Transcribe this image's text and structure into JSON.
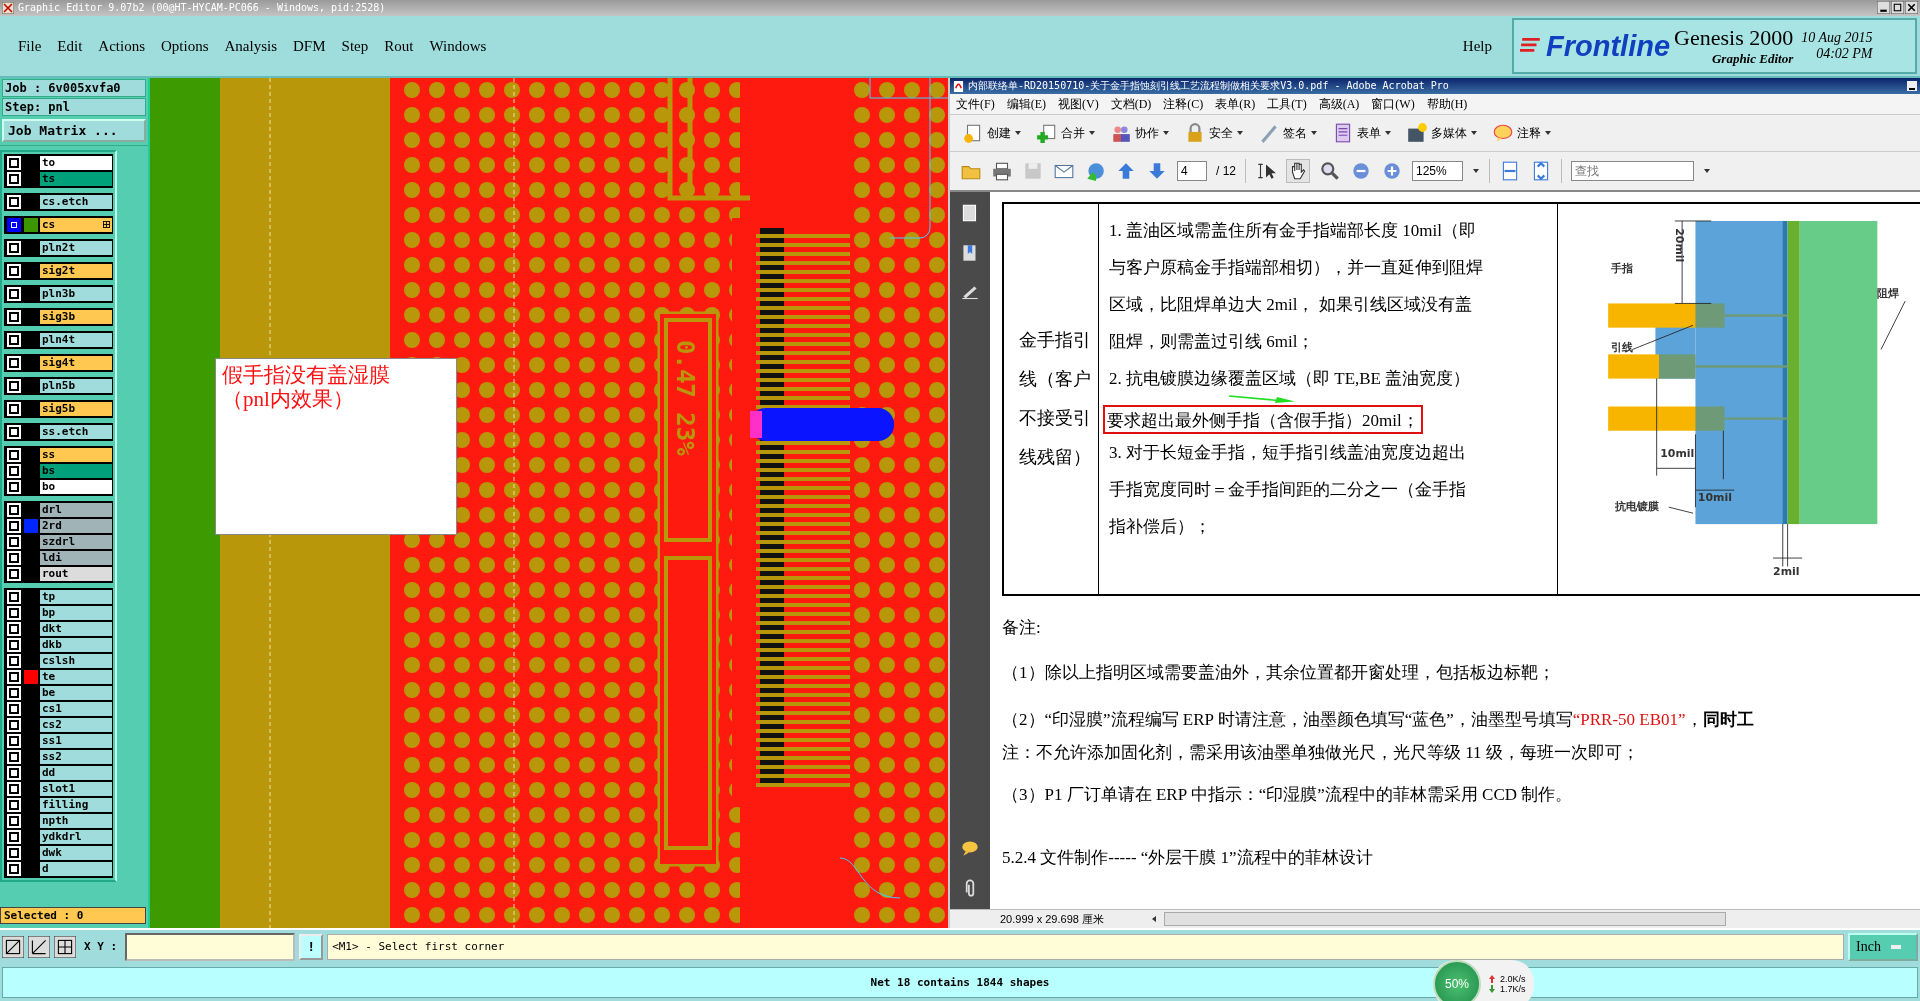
{
  "title_bar": {
    "title": "Graphic Editor 9.07b2 (00@HT-HYCAM-PC066 - Windows, pid:2528)"
  },
  "menu": [
    "File",
    "Edit",
    "Actions",
    "Options",
    "Analysis",
    "DFM",
    "Step",
    "Rout",
    "Windows"
  ],
  "help": "Help",
  "brand": {
    "logo": "Frontline",
    "product": "Genesis 2000",
    "subtitle": "Graphic Editor",
    "date": "10 Aug 2015",
    "time": "04:02 PM"
  },
  "job": {
    "job": "Job : 6v005xvfa0",
    "step": "Step: pnl",
    "matrix_button": "Job Matrix ..."
  },
  "layer_groups": [
    {
      "layers": [
        {
          "name": "to",
          "color": "#ffffff",
          "selected": false
        },
        {
          "name": "ts",
          "color": "#00a07a",
          "selected": false
        }
      ]
    },
    {
      "layers": [
        {
          "name": "cs.etch",
          "color": "#a0dcdc",
          "selected": false
        }
      ]
    },
    {
      "layers": [
        {
          "name": "cs",
          "color": "#ffc850",
          "selected": true,
          "swatch": {
            "color": "#3c9600"
          }
        }
      ]
    },
    {
      "layers": [
        {
          "name": "pln2t",
          "color": "#a0dcdc",
          "selected": false
        }
      ]
    },
    {
      "layers": [
        {
          "name": "sig2t",
          "color": "#ffc850",
          "selected": false
        }
      ]
    },
    {
      "layers": [
        {
          "name": "pln3b",
          "color": "#a0dcdc",
          "selected": false
        }
      ]
    },
    {
      "layers": [
        {
          "name": "sig3b",
          "color": "#ffc850",
          "selected": false
        }
      ]
    },
    {
      "layers": [
        {
          "name": "pln4t",
          "color": "#a0dcdc",
          "selected": false
        }
      ]
    },
    {
      "layers": [
        {
          "name": "sig4t",
          "color": "#ffc850",
          "selected": false
        }
      ]
    },
    {
      "layers": [
        {
          "name": "pln5b",
          "color": "#a0dcdc",
          "selected": false
        }
      ]
    },
    {
      "layers": [
        {
          "name": "sig5b",
          "color": "#ffc850",
          "selected": false
        }
      ]
    },
    {
      "layers": [
        {
          "name": "ss.etch",
          "color": "#a0dcdc",
          "selected": false
        }
      ]
    },
    {
      "layers": [
        {
          "name": "ss",
          "color": "#ffc850",
          "selected": false
        },
        {
          "name": "bs",
          "color": "#00a07a",
          "selected": false
        },
        {
          "name": "bo",
          "color": "#ffffff",
          "selected": false
        }
      ]
    },
    {
      "layers": [
        {
          "name": "drl",
          "color": "#a0b4b8",
          "selected": false
        },
        {
          "name": "2rd",
          "color": "#a0b4b8",
          "selected": false,
          "swatch": {
            "color": "#0026ff"
          }
        },
        {
          "name": "szdrl",
          "color": "#a0b4b8",
          "selected": false
        },
        {
          "name": "ldi",
          "color": "#a0b4b8",
          "selected": false
        },
        {
          "name": "rout",
          "color": "#dcdcdc",
          "selected": false
        }
      ]
    },
    {
      "layers": [
        {
          "name": "tp",
          "color": "#a0dcdc",
          "selected": false
        },
        {
          "name": "bp",
          "color": "#a0dcdc",
          "selected": false
        },
        {
          "name": "dkt",
          "color": "#a0dcdc",
          "selected": false
        },
        {
          "name": "dkb",
          "color": "#a0dcdc",
          "selected": false
        },
        {
          "name": "cslsh",
          "color": "#a0dcdc",
          "selected": false
        },
        {
          "name": "te",
          "color": "#a0dcdc",
          "selected": false,
          "swatch": {
            "color": "#ff0000"
          }
        },
        {
          "name": "be",
          "color": "#a0dcdc",
          "selected": false
        },
        {
          "name": "cs1",
          "color": "#a0dcdc",
          "selected": false
        },
        {
          "name": "cs2",
          "color": "#a0dcdc",
          "selected": false
        },
        {
          "name": "ss1",
          "color": "#a0dcdc",
          "selected": false
        },
        {
          "name": "ss2",
          "color": "#a0dcdc",
          "selected": false
        },
        {
          "name": "dd",
          "color": "#a0dcdc",
          "selected": false
        },
        {
          "name": "slot1",
          "color": "#a0dcdc",
          "selected": false
        },
        {
          "name": "filling",
          "color": "#a0dcdc",
          "selected": false
        },
        {
          "name": "npth",
          "color": "#a0dcdc",
          "selected": false
        },
        {
          "name": "ydkdrl",
          "color": "#a0dcdc",
          "selected": false
        },
        {
          "name": "dwk",
          "color": "#a0dcdc",
          "selected": false
        },
        {
          "name": "d",
          "color": "#a0dcdc",
          "selected": false
        }
      ]
    }
  ],
  "selected_count": "Selected : 0",
  "canvas": {
    "board_label": "0.47 23%",
    "note": [
      "假手指没有盖湿膜",
      "（pnl内效果）"
    ]
  },
  "pdf": {
    "title": "内部联络单-RD20150710-关于金手指蚀刻引线工艺流程制做相关要求V3.0.pdf - Adobe Acrobat Pro",
    "menu": [
      "文件(F)",
      "编辑(E)",
      "视图(V)",
      "文档(D)",
      "注释(C)",
      "表单(R)",
      "工具(T)",
      "高级(A)",
      "窗口(W)",
      "帮助(H)"
    ],
    "tasks": [
      "创建",
      "合并",
      "协作",
      "安全",
      "签名",
      "表单",
      "多媒体",
      "注释"
    ],
    "page": "4",
    "page_total": "/ 12",
    "zoom": "125%",
    "search": {
      "placeholder": "查找"
    },
    "table": {
      "topic": "金手指引线（客户不接受引线残留）",
      "lines": [
        {
          "text": "1.  盖油区域需盖住所有金手指端部长度 10mil（即",
          "boxed": false
        },
        {
          "text": "与客户原稿金手指端部相切），并一直延伸到阻焊",
          "boxed": false
        },
        {
          "text": "区域，比阻焊单边大 2mil，  如果引线区域没有盖",
          "boxed": false
        },
        {
          "text": "阻焊，则需盖过引线 6mil；",
          "boxed": false
        },
        {
          "text": "2.  抗电镀膜边缘覆盖区域（即 TE,BE 盖油宽度）",
          "boxed": false
        },
        {
          "text": "要求超出最外侧手指（含假手指）20mil；",
          "boxed": true
        },
        {
          "text": "3.  对于长短金手指，短手指引线盖油宽度边超出",
          "boxed": false
        },
        {
          "text": "手指宽度同时＝金手指间距的二分之一（金手指",
          "boxed": false
        },
        {
          "text": "指补偿后）；",
          "boxed": false
        }
      ],
      "figure_labels": [
        "20mil",
        "手指",
        "引线",
        "阻焊",
        "10mil",
        "10mil",
        "抗电镀膜",
        "2mil"
      ]
    },
    "remarks_title": "备注:",
    "remarks": [
      [
        {
          "text": "（1）除以上指明区域需要盖油外，其余位置都开窗处理，包括板边标靶；",
          "kind": "plain"
        }
      ],
      [
        {
          "text": "（2）“印湿膜”流程编写 ERP 时请注意，油墨颜色填写“蓝色”，油墨型号填写",
          "kind": "plain"
        },
        {
          "text": "“PRR-50 EB01”",
          "kind": "red"
        },
        {
          "text": "，",
          "kind": "plain"
        },
        {
          "text": "同时工",
          "kind": "bold"
        }
      ],
      [
        {
          "text": "注：不允许添加固化剂，需采用该油墨单独做光尺，光尺等级 11 级，每班一次即可；",
          "kind": "plain"
        }
      ],
      [
        {
          "text": "（3）P1 厂订单请在 ERP 中指示：“印湿膜”流程中的菲林需采用 CCD 制作。",
          "kind": "plain"
        }
      ]
    ],
    "section_heading": "5.2.4 文件制作----- “外层干膜 1”流程中的菲林设计",
    "status": "20.999 x 29.698 厘米"
  },
  "command_bar": {
    "xy_label": "X Y :",
    "bang": "!",
    "prompt": "<M1> - Select first corner",
    "unit": "Inch"
  },
  "status": "Net 18 contains 1844 shapes",
  "network": {
    "percent": "50%",
    "up": "2.0K/s",
    "down": "1.7K/s"
  }
}
